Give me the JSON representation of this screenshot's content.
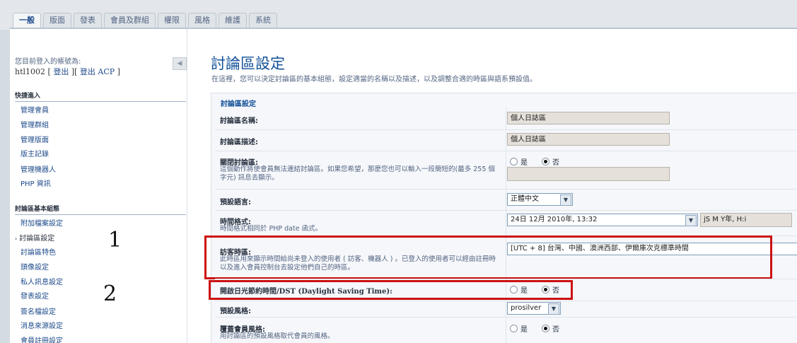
{
  "tabs": [
    "一般",
    "版面",
    "發表",
    "會員及群組",
    "權限",
    "風格",
    "維護",
    "系統"
  ],
  "login": {
    "label": "您目前登入的帳號為:",
    "username": "htl1002",
    "logout": "登出",
    "logout_acp": "登出 ACP"
  },
  "quick_access": {
    "heading": "快捷進入",
    "items": [
      "管理會員",
      "管理群組",
      "管理版面",
      "版主記錄",
      "管理機器人",
      "PHP 資訊"
    ]
  },
  "board_config": {
    "heading": "討論區基本組態",
    "items": [
      "附加檔案設定",
      "討論區設定",
      "討論區特色",
      "頭像設定",
      "私人訊息設定",
      "發表設定",
      "簽名檔設定",
      "消息來源設定",
      "會員註冊設定"
    ],
    "current_index": 1
  },
  "annotations": {
    "n1": "1",
    "n2": "2"
  },
  "page": {
    "title": "討論區設定",
    "description": "在這裡，您可以決定討論區的基本組態，設定適當的名稱以及描述，以及調整合適的時區與語系預設值。"
  },
  "settings": {
    "legend": "討論區設定",
    "site_name": {
      "label": "討論區名稱:",
      "value": "個人日誌區"
    },
    "site_desc": {
      "label": "討論區描述:",
      "value": "個人日誌區"
    },
    "board_disable": {
      "label": "關閉討論區:",
      "explain": "這個動作將使會員無法連結討論區。如果您希望，那麼您也可以輸入一段簡短的(最多 255 個字元) 訊息去顯示。",
      "yes": "是",
      "no": "否",
      "value": "",
      "selected": "no"
    },
    "default_lang": {
      "label": "預設語言:",
      "value": "正體中文"
    },
    "date_format": {
      "label": "時間格式:",
      "explain": "時間格式相同於 PHP date 函式。",
      "value": "24日 12月 2010年, 13:32",
      "custom": "jS M Y年, H:i"
    },
    "timezone": {
      "label": "訪客時區:",
      "explain": "此時區用來顯示時間給尚未登入的使用者 ( 訪客、機器人 ) 。已登入的使用者可以經由註冊時以及進入會員控制台去設定他們自己的時區。",
      "value": "[UTC + 8] 台灣、中國、澳洲西部、伊爾庫次克標準時間"
    },
    "dst": {
      "label": "開啟日光節約時間/DST (Daylight Saving Time):",
      "yes": "是",
      "no": "否",
      "selected": "no"
    },
    "default_style": {
      "label": "預設風格:",
      "value": "prosilver"
    },
    "override_style": {
      "label": "覆蓋會員風格:",
      "explain": "用討論區的預設風格取代會員的風格。",
      "yes": "是",
      "no": "否",
      "selected": "no"
    }
  },
  "colors": {
    "highlight": "#cc1111",
    "title": "#115098",
    "link": "#1d4a8a"
  }
}
